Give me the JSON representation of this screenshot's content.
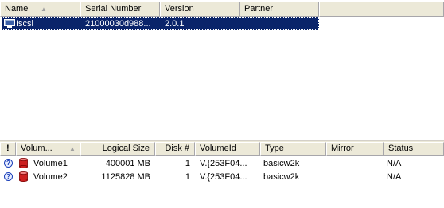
{
  "top_list": {
    "columns": [
      "Name",
      "Serial Number",
      "Version",
      "Partner"
    ],
    "rows": [
      {
        "name": "Iscsi",
        "serial": "21000030d988...",
        "version": "2.0.1",
        "partner": ""
      }
    ]
  },
  "bottom_list": {
    "columns": [
      "!",
      "Volum...",
      "Logical Size",
      "Disk #",
      "VolumeId",
      "Type",
      "Mirror",
      "Status"
    ],
    "rows": [
      {
        "icon": "?",
        "name": "Volume1",
        "size": "400001 MB",
        "disk": "1",
        "volume_id": "V.{253F04...",
        "type": "basicw2k",
        "mirror": "",
        "status": "N/A"
      },
      {
        "icon": "?",
        "name": "Volume2",
        "size": "1125828 MB",
        "disk": "1",
        "volume_id": "V.{253F04...",
        "type": "basicw2k",
        "mirror": "",
        "status": "N/A"
      }
    ]
  },
  "colors": {
    "selection": "#0a246a",
    "header_bg": "#ece9d8",
    "volume_icon": "#cc2020"
  }
}
